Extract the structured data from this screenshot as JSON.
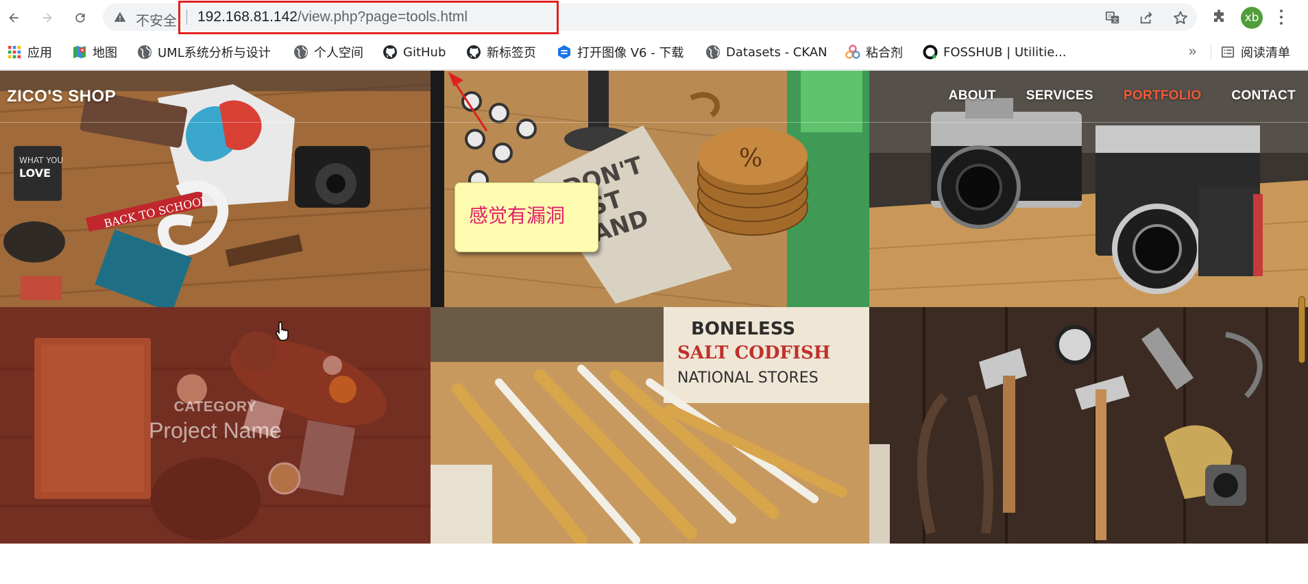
{
  "browser": {
    "insecure_label": "不安全",
    "url_host": "192.168.81.142",
    "url_path": "/view.php?page=tools.html",
    "profile_initials": "xb",
    "accent": "#4f9e3a"
  },
  "bookmarks": {
    "items": [
      {
        "label": "应用",
        "icon": "apps-grid-icon"
      },
      {
        "label": "地图",
        "icon": "maps-icon"
      },
      {
        "label": "UML系统分析与设计",
        "icon": "globe-icon"
      },
      {
        "label": "个人空间",
        "icon": "globe-icon"
      },
      {
        "label": "GitHub",
        "icon": "github-icon"
      },
      {
        "label": "新标签页",
        "icon": "github-icon"
      },
      {
        "label": "打开图像 V6 - 下载",
        "icon": "image-app-icon"
      },
      {
        "label": "Datasets - CKAN",
        "icon": "globe-icon"
      },
      {
        "label": "粘合剂",
        "icon": "binder-icon"
      },
      {
        "label": "FOSSHUB | Utilitie...",
        "icon": "fosshub-icon"
      }
    ],
    "more": "»",
    "reading_list": "阅读清单"
  },
  "site": {
    "logo": "ZICO'S SHOP",
    "nav": [
      "ABOUT",
      "SERVICES",
      "PORTFOLIO",
      "CONTACT"
    ],
    "active_nav": "PORTFOLIO",
    "active_color": "#f05a38",
    "hover_tile": {
      "category": "CATEGORY",
      "project": "Project Name"
    }
  },
  "annotation": {
    "note_text": "感觉有漏洞",
    "note_color": "#fdfbb0",
    "text_color": "#e0206a",
    "box_color": "#e02020"
  }
}
